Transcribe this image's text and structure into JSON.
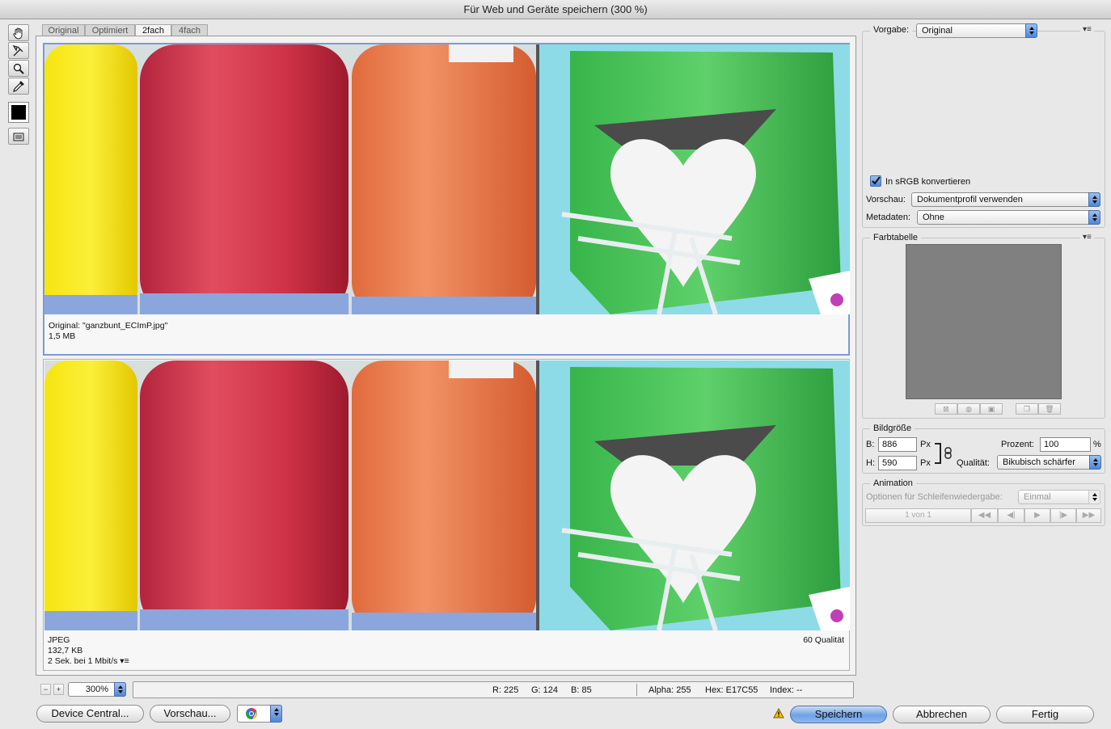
{
  "window": {
    "title": "Für Web und Geräte speichern (300 %)"
  },
  "tabs": [
    "Original",
    "Optimiert",
    "2fach",
    "4fach"
  ],
  "active_tab": "2fach",
  "panes": {
    "top": {
      "line1": "Original: \"ganzbunt_ECImP.jpg\"",
      "line2": "1,5 MB"
    },
    "bottom": {
      "line1": "JPEG",
      "line2": "132,7 KB",
      "line3": "2 Sek. bei 1 Mbit/s",
      "quality": "60 Qualität"
    }
  },
  "zoom": {
    "value": "300%",
    "minus": "−",
    "plus": "+"
  },
  "status": {
    "r": "R: 225",
    "g": "G: 124",
    "b": "B: 85",
    "alpha": "Alpha: 255",
    "hex": "Hex: E17C55",
    "index": "Index: --"
  },
  "bottom_buttons": {
    "device_central": "Device Central...",
    "preview": "Vorschau...",
    "save": "Speichern",
    "cancel": "Abbrechen",
    "done": "Fertig"
  },
  "right": {
    "preset_label": "Vorgabe:",
    "preset_value": "Original",
    "convert_srgb": "In sRGB konvertieren",
    "convert_checked": true,
    "preview_label": "Vorschau:",
    "preview_value": "Dokumentprofil verwenden",
    "metadata_label": "Metadaten:",
    "metadata_value": "Ohne",
    "color_table_title": "Farbtabelle",
    "image_size_title": "Bildgröße",
    "width_label": "B:",
    "width_value": "886",
    "height_label": "H:",
    "height_value": "590",
    "unit": "Px",
    "percent_label": "Prozent:",
    "percent_value": "100",
    "percent_unit": "%",
    "quality_label": "Qualität:",
    "quality_value": "Bikubisch schärfer",
    "animation_title": "Animation",
    "loop_label": "Optionen für Schleifenwiedergabe:",
    "loop_value": "Einmal",
    "frame_counter": "1 von 1"
  },
  "colors": {
    "accent": "#6fa1e4",
    "swatch": "#808080"
  }
}
